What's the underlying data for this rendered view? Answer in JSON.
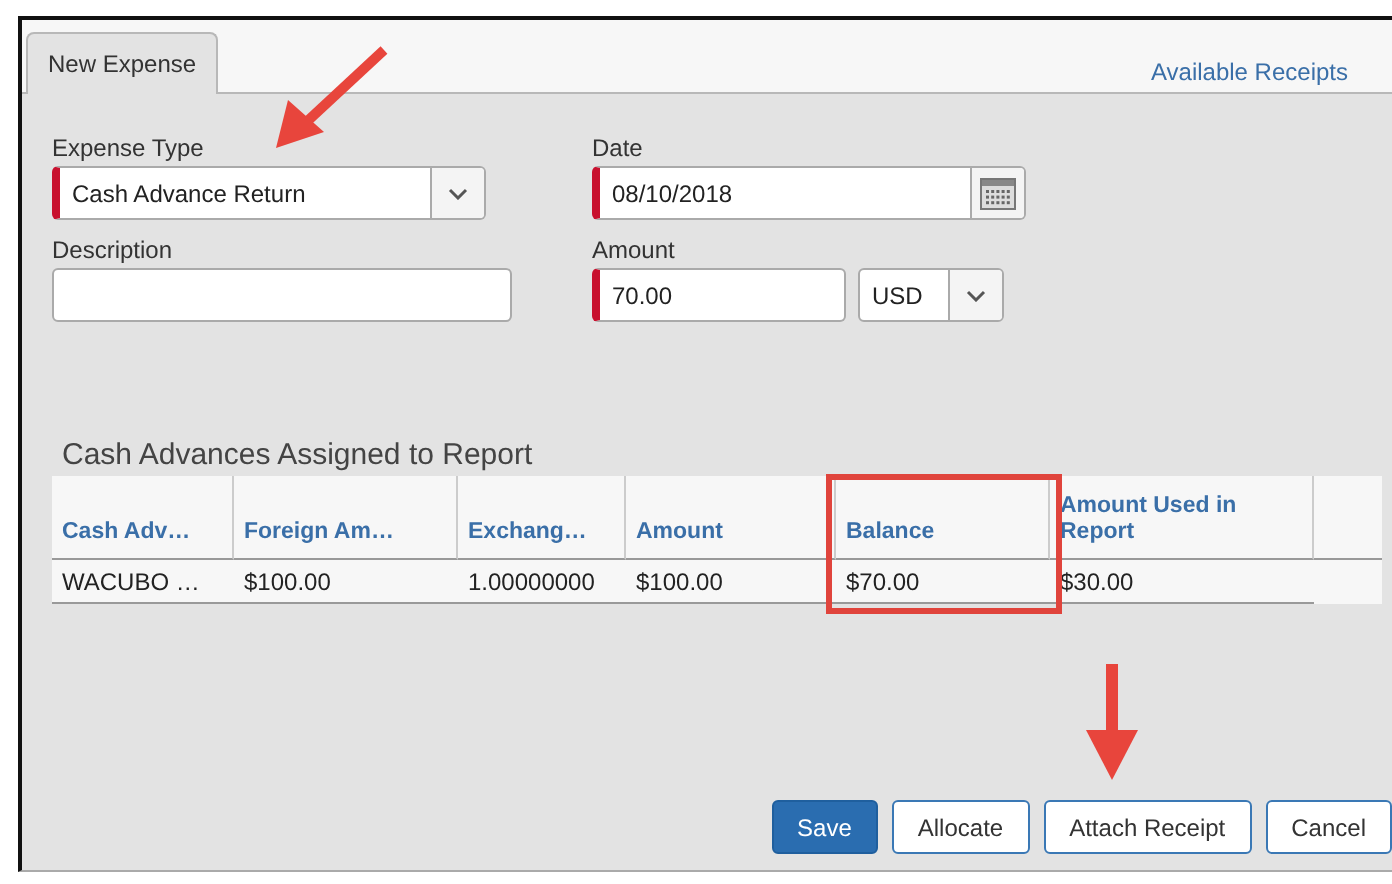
{
  "tabs": [
    {
      "label": "New Expense",
      "selected": true
    }
  ],
  "available_receipts_link": "Available Receipts",
  "fields": [
    {
      "label": "Expense Type",
      "value": "Cash Advance Return",
      "required": true,
      "kind": "select"
    },
    {
      "label": "Date",
      "value": "08/10/2018",
      "required": true,
      "kind": "date"
    },
    {
      "label": "Description",
      "required": false,
      "kind": "text"
    },
    {
      "label": "Amount",
      "value": "70.00",
      "required": true,
      "kind": "amount",
      "currency": "USD"
    }
  ],
  "table": {
    "title": "Cash Advances Assigned to Report",
    "columns": [
      "Cash Adv…",
      "Foreign Am…",
      "Exchang…",
      "Amount",
      "Balance",
      "Amount Used in Report"
    ],
    "rows": [
      [
        "WACUBO …",
        "$100.00",
        "1.00000000",
        "$100.00",
        "$70.00",
        "$30.00"
      ]
    ]
  },
  "buttons": [
    {
      "label": "Save",
      "primary": true
    },
    {
      "label": "Allocate",
      "primary": false
    },
    {
      "label": "Attach Receipt",
      "primary": false
    },
    {
      "label": "Cancel",
      "primary": false
    }
  ]
}
